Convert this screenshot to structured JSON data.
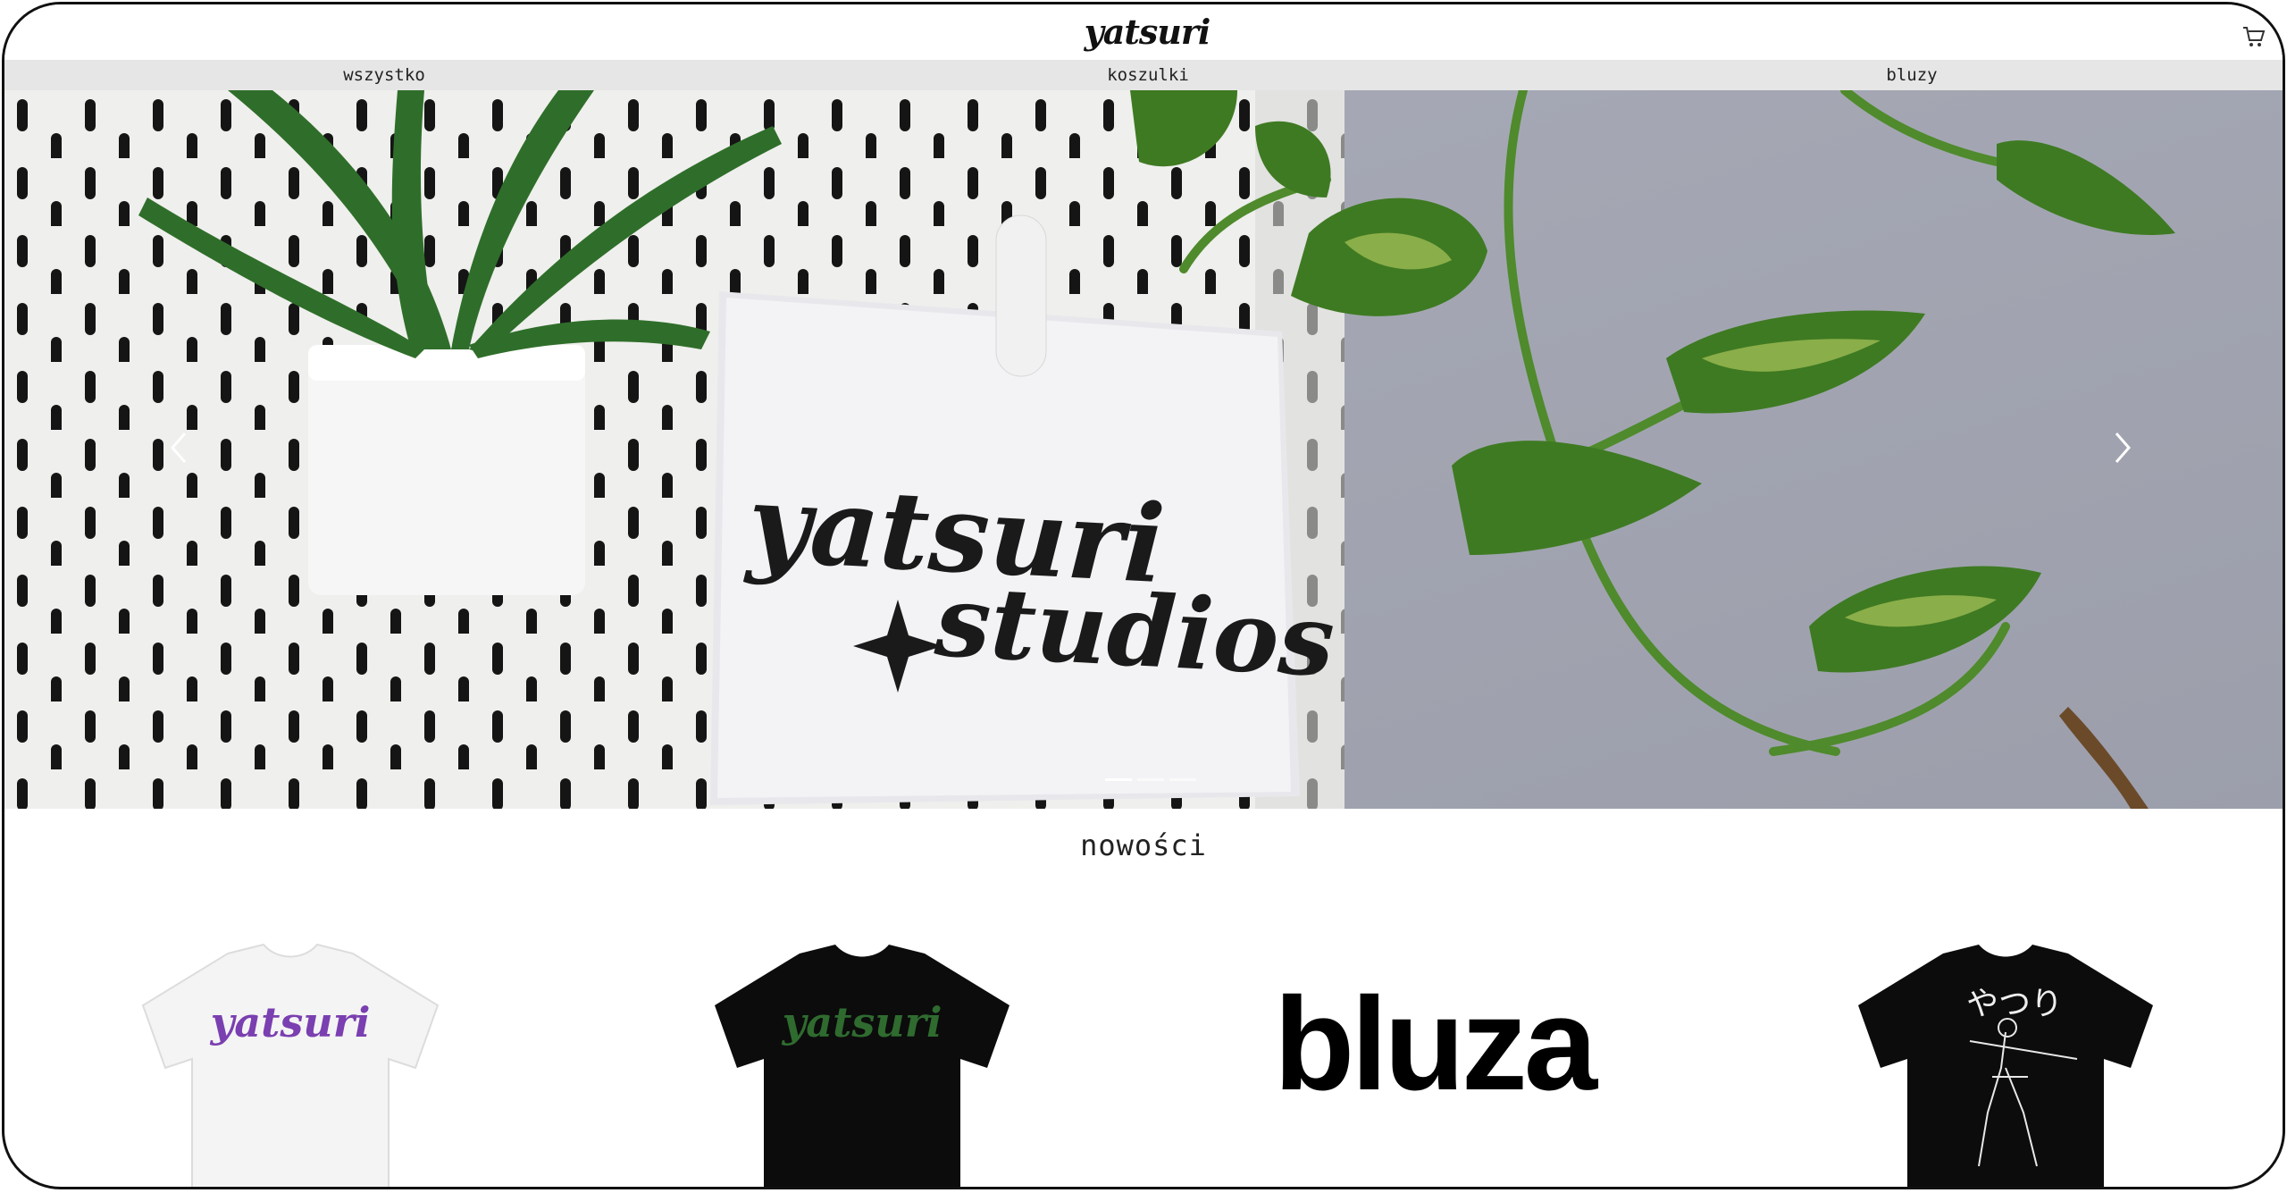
{
  "header": {
    "logo_alt": "yatsuri",
    "cart_icon": "cart-icon"
  },
  "nav": {
    "items": [
      {
        "label": "wszystko"
      },
      {
        "label": "koszulki"
      },
      {
        "label": "bluzy"
      }
    ]
  },
  "hero": {
    "sign_text_line1": "yatsuri",
    "sign_text_line2": "studios",
    "slide_count": 3,
    "active_slide": 1,
    "prev_icon": "chevron-left-icon",
    "next_icon": "chevron-right-icon"
  },
  "section": {
    "title": "nowości"
  },
  "products": [
    {
      "kind": "tshirt",
      "shirt_color": "#f4f4f4",
      "print_color": "#7a3fb0",
      "print_text": "yatsuri"
    },
    {
      "kind": "tshirt",
      "shirt_color": "#0c0c0c",
      "print_color": "#2f6b2f",
      "print_text": "yatsuri"
    },
    {
      "kind": "text",
      "label": "bluza"
    },
    {
      "kind": "tshirt",
      "shirt_color": "#0c0c0c",
      "print_color": "#eeeeee",
      "print_text": "やつり"
    }
  ]
}
